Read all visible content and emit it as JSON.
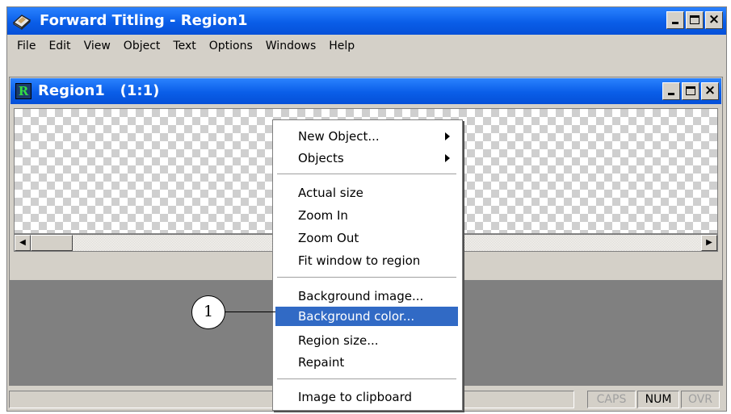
{
  "app": {
    "title": "Forward Titling - Region1",
    "icon": "forward-titling-app-icon"
  },
  "window_buttons": {
    "minimize": "minimize",
    "maximize": "maximize",
    "close": "×"
  },
  "menubar": [
    "File",
    "Edit",
    "View",
    "Object",
    "Text",
    "Options",
    "Windows",
    "Help"
  ],
  "child": {
    "title": "Region1   (1:1)",
    "icon_letter": "R"
  },
  "scrollbar": {
    "left_arrow": "◀",
    "right_arrow": "▶"
  },
  "context_menu": {
    "items": [
      {
        "label": "New Object...",
        "submenu": true
      },
      {
        "label": "Objects",
        "submenu": true
      },
      {
        "label": "Actual size"
      },
      {
        "label": "Zoom In"
      },
      {
        "label": "Zoom Out"
      },
      {
        "label": "Fit window to region"
      },
      {
        "label": "Background image..."
      },
      {
        "label": "Background color...",
        "highlighted": true
      },
      {
        "label": "Region size..."
      },
      {
        "label": "Repaint"
      },
      {
        "label": "Image to clipboard"
      }
    ]
  },
  "callout": {
    "number": "1"
  },
  "statusbar": {
    "indicators": [
      {
        "label": "CAPS",
        "active": false
      },
      {
        "label": "NUM",
        "active": true
      },
      {
        "label": "OVR",
        "active": false
      }
    ]
  },
  "colors": {
    "titlebar": "#0a5ee8",
    "highlight": "#316ac5",
    "mdi_background": "#808080",
    "chrome": "#d4d0c8"
  }
}
